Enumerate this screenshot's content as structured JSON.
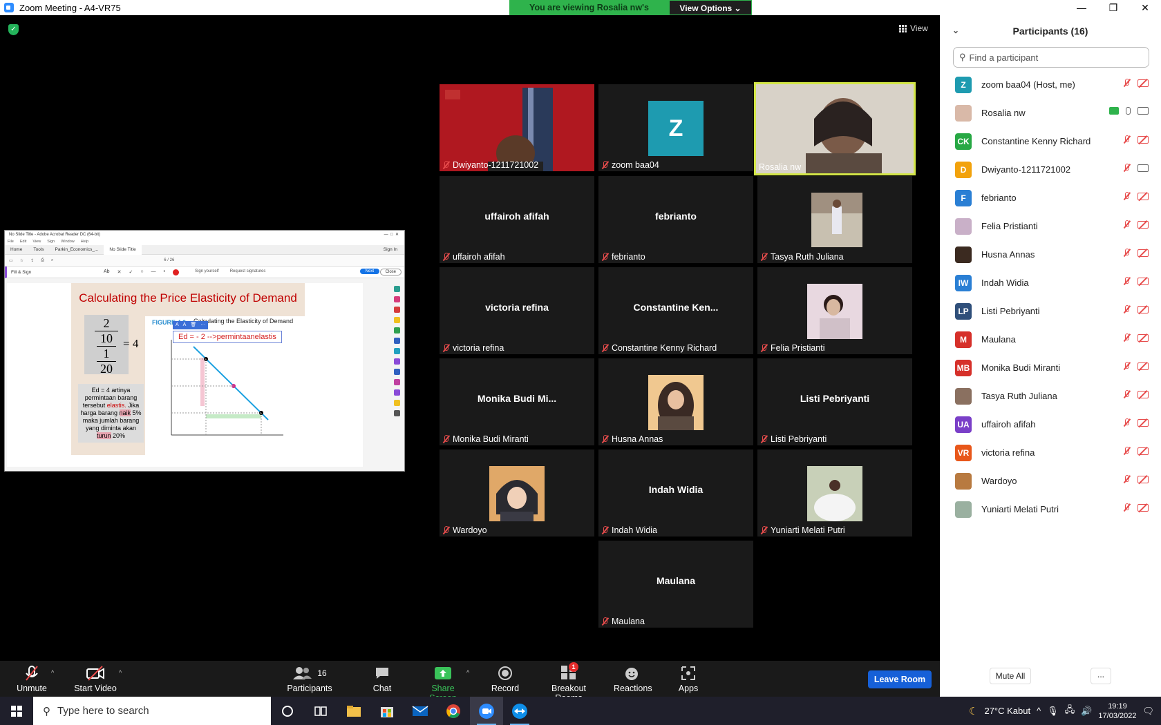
{
  "window": {
    "title": "Zoom Meeting - A4-VR75",
    "banner_text": "You are viewing Rosalia nw's screen",
    "view_options": "View Options ⌄",
    "view_label": "View",
    "minimize": "—",
    "maximize": "❐",
    "close": "✕"
  },
  "shared_screen": {
    "acrobat_title": "No Slide Title - Adobe Acrobat Reader DC (64-bit)",
    "menu": [
      "File",
      "Edit",
      "View",
      "Sign",
      "Window",
      "Help"
    ],
    "tabs": [
      "Home",
      "Tools",
      "Parkin_Economics_...",
      "No Slide Title"
    ],
    "sign_in": "Sign In",
    "page_indicator": "6 / 26",
    "fill_sign": "Fill & Sign",
    "sign_yourself": "Sign yourself",
    "request_signatures": "Request signatures",
    "next": "Next",
    "close": "Close",
    "slide_title": "Calculating the Price Elasticity of Demand",
    "fraction_top": "2",
    "fraction_mid1": "10",
    "fraction_mid2": "1",
    "fraction_bot": "20",
    "fraction_eq": "= 4",
    "note_1": "Ed = 4 artinya permintaan barang tersebut ",
    "note_elastis": "elastis.",
    "note_2": " Jika harga barang ",
    "note_naik": "naik",
    "note_3": " 5% maka jumlah barang yang diminta akan ",
    "note_turun": "turun",
    "note_4": " 20%",
    "figure_label": "FIGURE 4.2",
    "figure_title": "Calculating the Elasticity of Demand",
    "ed_annotation": "Ed = - 2 -->permintaanelastis"
  },
  "tiles": [
    {
      "name": "Dwiyanto-1211721002"
    },
    {
      "name": "zoom baa04",
      "initial": "Z"
    },
    {
      "name": "Rosalia nw"
    },
    {
      "name": "uffairoh afifah",
      "center": "uffairoh afifah"
    },
    {
      "name": "febrianto",
      "center": "febrianto"
    },
    {
      "name": "Tasya Ruth Juliana"
    },
    {
      "name": "victoria refina",
      "center": "victoria refina"
    },
    {
      "name": "Constantine Kenny Richard",
      "center": "Constantine  Ken..."
    },
    {
      "name": "Felia Pristianti"
    },
    {
      "name": "Monika Budi Miranti",
      "center": "Monika  Budi  Mi..."
    },
    {
      "name": "Husna Annas"
    },
    {
      "name": "Listi Pebriyanti",
      "center": "Listi Pebriyanti"
    },
    {
      "name": "Wardoyo"
    },
    {
      "name": "Indah Widia",
      "center": "Indah Widia"
    },
    {
      "name": "Yuniarti Melati Putri"
    },
    {
      "name": "Maulana",
      "center": "Maulana"
    }
  ],
  "toolbar": {
    "unmute": "Unmute",
    "start_video": "Start Video",
    "participants": "Participants",
    "participants_count": "16",
    "chat": "Chat",
    "share_screen": "Share Screen",
    "record": "Record",
    "breakout_rooms": "Breakout Rooms",
    "breakout_badge": "1",
    "reactions": "Reactions",
    "apps": "Apps",
    "leave_room": "Leave Room"
  },
  "panel": {
    "title": "Participants (16)",
    "search_placeholder": "Find a participant",
    "participants": [
      {
        "initials": "Z",
        "name": "zoom baa04 (Host, me)",
        "color": "#1e9bb0"
      },
      {
        "initials": "",
        "name": "Rosalia nw",
        "color": "#d9b9a8"
      },
      {
        "initials": "CK",
        "name": "Constantine Kenny Richard",
        "color": "#27a844"
      },
      {
        "initials": "D",
        "name": "Dwiyanto-1211721002",
        "color": "#f2a20c"
      },
      {
        "initials": "F",
        "name": "febrianto",
        "color": "#2a7fd4"
      },
      {
        "initials": "",
        "name": "Felia Pristianti",
        "color": "#c9b0c8"
      },
      {
        "initials": "",
        "name": "Husna Annas",
        "color": "#3b2a20"
      },
      {
        "initials": "IW",
        "name": "Indah Widia",
        "color": "#2a7fd4"
      },
      {
        "initials": "LP",
        "name": "Listi Pebriyanti",
        "color": "#2f4f7a"
      },
      {
        "initials": "M",
        "name": "Maulana",
        "color": "#d6302a"
      },
      {
        "initials": "MB",
        "name": "Monika Budi Miranti",
        "color": "#d6302a"
      },
      {
        "initials": "",
        "name": "Tasya Ruth Juliana",
        "color": "#8a7060"
      },
      {
        "initials": "UA",
        "name": "uffairoh afifah",
        "color": "#7a3fc8"
      },
      {
        "initials": "VR",
        "name": "victoria refina",
        "color": "#e8571a"
      },
      {
        "initials": "",
        "name": "Wardoyo",
        "color": "#b87a40"
      },
      {
        "initials": "",
        "name": "Yuniarti Melati Putri",
        "color": "#9ab0a0"
      }
    ],
    "mute_all": "Mute All",
    "more": "..."
  },
  "taskbar": {
    "search_placeholder": "Type here to search",
    "weather": "27°C  Kabut",
    "time": "19:19",
    "date": "17/03/2022"
  }
}
